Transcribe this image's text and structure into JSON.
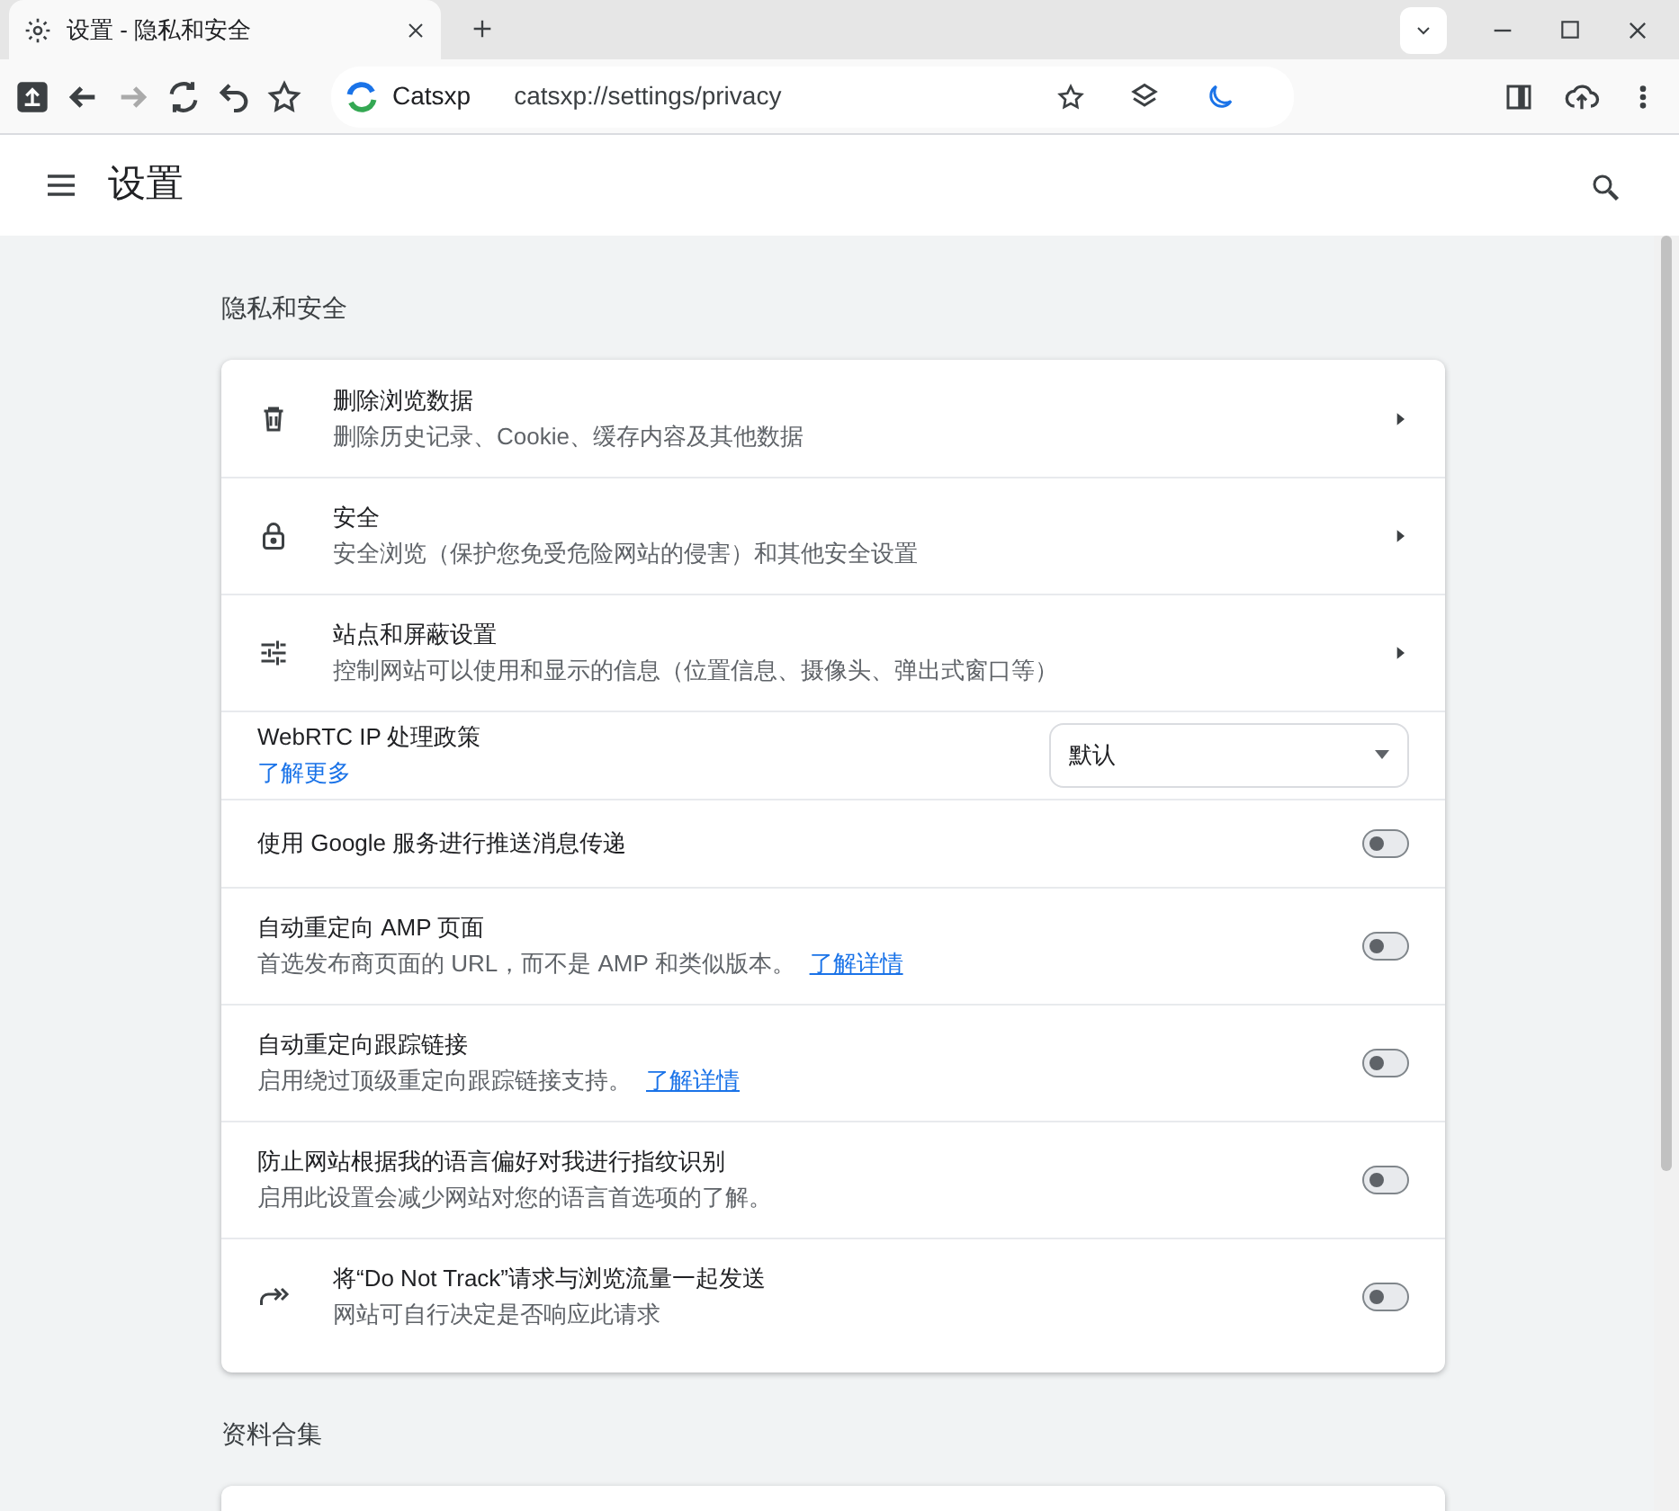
{
  "browser": {
    "tab": {
      "title": "设置 - 隐私和安全",
      "selected": true
    },
    "address": {
      "site": "Catsxp",
      "url": "catsxp://settings/privacy"
    }
  },
  "header": {
    "title": "设置"
  },
  "sections": [
    {
      "title": "隐私和安全",
      "rows": [
        {
          "kind": "link",
          "title": "删除浏览数据",
          "subtitle": "删除历史记录、Cookie、缓存内容及其他数据"
        },
        {
          "kind": "link",
          "title": "安全",
          "subtitle": "安全浏览（保护您免受危险网站的侵害）和其他安全设置"
        },
        {
          "kind": "link",
          "title": "站点和屏蔽设置",
          "subtitle": "控制网站可以使用和显示的信息（位置信息、摄像头、弹出式窗口等）"
        },
        {
          "kind": "select",
          "title": "WebRTC IP 处理政策",
          "link": "了解更多",
          "value": "默认"
        },
        {
          "kind": "toggle",
          "title": "使用 Google 服务进行推送消息传递",
          "on": false
        },
        {
          "kind": "toggle",
          "title": "自动重定向 AMP 页面",
          "subtitle": "首选发布商页面的 URL，而不是 AMP 和类似版本。",
          "link": "了解详情",
          "on": false
        },
        {
          "kind": "toggle",
          "title": "自动重定向跟踪链接",
          "subtitle": "启用绕过顶级重定向跟踪链接支持。",
          "link": "了解详情",
          "on": false
        },
        {
          "kind": "toggle",
          "title": "防止网站根据我的语言偏好对我进行指纹识别",
          "subtitle": "启用此设置会减少网站对您的语言首选项的了解。",
          "on": false
        },
        {
          "kind": "toggle",
          "title": "将“Do Not Track”请求与浏览流量一起发送",
          "subtitle": "网站可自行决定是否响应此请求",
          "on": false
        }
      ]
    },
    {
      "title": "资料合集"
    }
  ]
}
